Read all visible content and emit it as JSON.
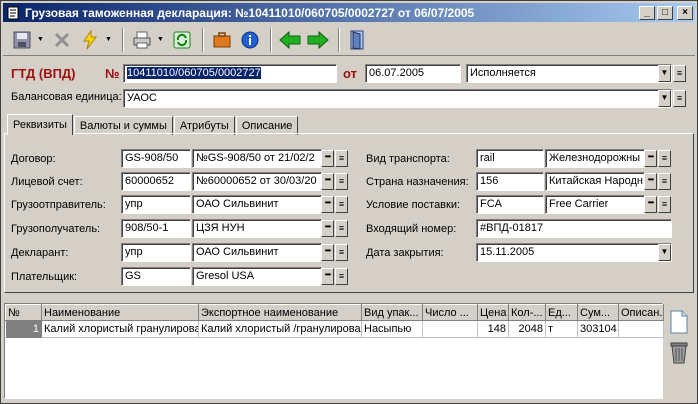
{
  "window": {
    "title": "Грузовая таможенная декларация: №10411010/060705/0002727 от 06/07/2005",
    "minimize": "_",
    "maximize": "□",
    "close": "×"
  },
  "toolbar": {
    "icons": [
      "save-icon",
      "delete-icon",
      "lightning-icon",
      "print-icon",
      "refresh-icon",
      "briefcase-icon",
      "info-icon",
      "back-arrow-icon",
      "forward-arrow-icon",
      "exit-door-icon"
    ]
  },
  "header": {
    "doc_type": "ГТД (ВПД)",
    "number_label": "№",
    "number_value": "10411010/060705/0002727",
    "date_label": "от",
    "date_value": "06.07.2005",
    "status_value": "Исполняется",
    "balance_label": "Балансовая единица:",
    "balance_value": "УАОС"
  },
  "tabs": [
    "Реквизиты",
    "Валюты и суммы",
    "Атрибуты",
    "Описание"
  ],
  "requisites": {
    "left": [
      {
        "label": "Договор:",
        "code": "GS-908/50",
        "name": "№GS-908/50 от 21/02/2"
      },
      {
        "label": "Лицевой счет:",
        "code": "60000652",
        "name": "№60000652 от 30/03/20"
      },
      {
        "label": "Грузоотправитель:",
        "code": "упр",
        "name": "ОАО Сильвинит"
      },
      {
        "label": "Грузополучатель:",
        "code": "908/50-1",
        "name": "ЦЗЯ НУН"
      },
      {
        "label": "Декларант:",
        "code": "упр",
        "name": "ОАО Сильвинит"
      },
      {
        "label": "Плательщик:",
        "code": "GS",
        "name": "Gresol USA"
      }
    ],
    "right": [
      {
        "label": "Вид транспорта:",
        "code": "rail",
        "name": "Железнодорожны"
      },
      {
        "label": "Страна назначения:",
        "code": "156",
        "name": "Китайская Народн"
      },
      {
        "label": "Условие поставки:",
        "code": "FCA",
        "name": "Free Carrier"
      },
      {
        "label": "Входящий номер:",
        "value": "#ВПД-01817"
      },
      {
        "label": "Дата закрытия:",
        "value": "15.11.2005"
      }
    ]
  },
  "grid": {
    "columns": [
      "№",
      "Наименование",
      "Экспортное наименование",
      "Вид упак...",
      "Число ...",
      "Цена",
      "Кол-...",
      "Ед...",
      "Сум...",
      "Описан..."
    ],
    "rows": [
      [
        "1",
        "Калий хлористый гранулирова",
        "Калий хлористый /гранулирова",
        "Насыпью",
        "",
        "148",
        "2048",
        "т",
        "303104",
        ""
      ]
    ]
  },
  "dots": "•••",
  "menu_glyph": "≡",
  "dropdown_glyph": "▼"
}
